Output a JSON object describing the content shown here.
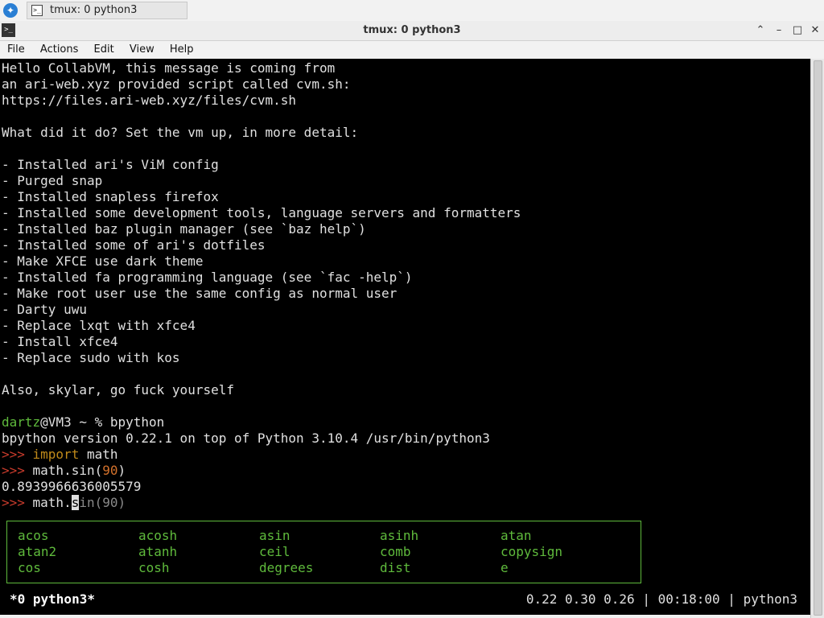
{
  "taskbar": {
    "task_label": "tmux: 0 python3"
  },
  "window": {
    "title": "tmux: 0 python3"
  },
  "menu": {
    "file": "File",
    "actions": "Actions",
    "edit": "Edit",
    "view": "View",
    "help": "Help"
  },
  "terminal": {
    "lines": [
      "Hello CollabVM, this message is coming from",
      "an ari-web.xyz provided script called cvm.sh:",
      "https://files.ari-web.xyz/files/cvm.sh",
      "",
      "What did it do? Set the vm up, in more detail:",
      "",
      "- Installed ari's ViM config",
      "- Purged snap",
      "- Installed snapless firefox",
      "- Installed some development tools, language servers and formatters",
      "- Installed baz plugin manager (see `baz help`)",
      "- Installed some of ari's dotfiles",
      "- Make XFCE use dark theme",
      "- Installed fa programming language (see `fac -help`)",
      "- Make root user use the same config as normal user",
      "- Darty uwu",
      "- Replace lxqt with xfce4",
      "- Install xfce4",
      "- Replace sudo with kos",
      "",
      "Also, skylar, go fuck yourself"
    ],
    "shell_user": "dartz",
    "shell_host": "@VM3 ~ % ",
    "shell_cmd": "bpython",
    "version_line": "bpython version 0.22.1 on top of Python 3.10.4 /usr/bin/python3",
    "repl_prompt": ">>> ",
    "import_kw": "import",
    "import_rest": " math",
    "sin_call_pre": "math.sin(",
    "sin_arg": "90",
    "sin_call_post": ")",
    "result": "0.8939966636005579",
    "typing_pre": "math.",
    "typing_cursor": "s",
    "typing_suggest": "in(90)",
    "completions": [
      "acos",
      "acosh",
      "asin",
      "asinh",
      "atan",
      "atan2",
      "atanh",
      "ceil",
      "comb",
      "copysign",
      "cos",
      "cosh",
      "degrees",
      "dist",
      "e"
    ]
  },
  "tmux_status": {
    "window": "*0 python3*",
    "load": "0.22 0.30 0.26",
    "sep": " | ",
    "time": "00:18:00",
    "session": "python3"
  },
  "colors": {
    "green": "#5fba3c",
    "prompt": "#c83b2c",
    "keyword": "#c08a1a",
    "number": "#d4722c"
  }
}
